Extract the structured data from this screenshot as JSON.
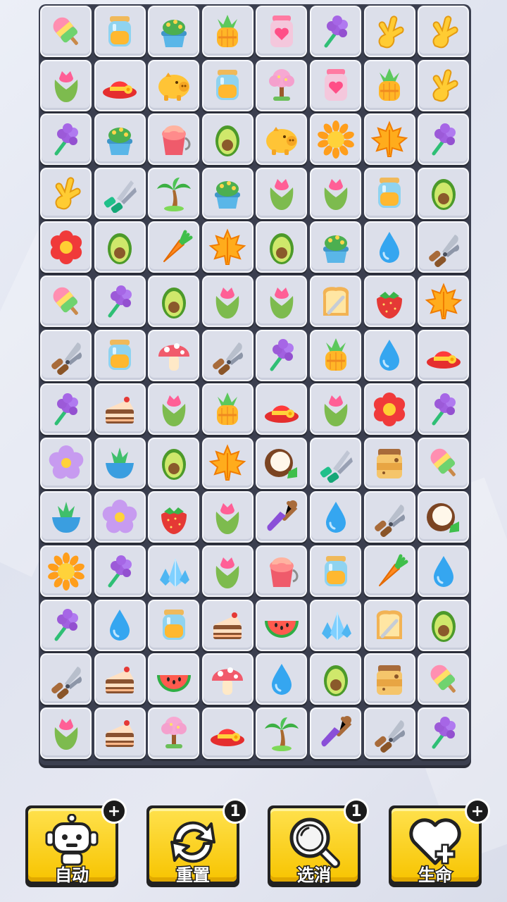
{
  "board": {
    "rows": [
      [
        "popsicle",
        "jar",
        "cactus-pot",
        "pineapple",
        "love-jar",
        "lavender",
        "ginger",
        "ginger"
      ],
      [
        "tulip",
        "red-hat",
        "gold-pig",
        "jar",
        "cherry-tree",
        "love-jar",
        "pineapple",
        "ginger"
      ],
      [
        "lavender",
        "cactus-pot",
        "paint-bucket",
        "avocado",
        "gold-pig",
        "sunflower",
        "maple-leaf",
        "lavender"
      ],
      [
        "ginger",
        "shears",
        "palm-tree",
        "cactus-pot",
        "tulip",
        "tulip",
        "jar",
        "avocado"
      ],
      [
        "red-flower",
        "avocado",
        "carrot",
        "maple-leaf",
        "avocado",
        "cactus-pot",
        "water-drop",
        "pruners"
      ],
      [
        "popsicle",
        "lavender",
        "avocado",
        "tulip",
        "tulip",
        "toast",
        "strawberry",
        "maple-leaf"
      ],
      [
        "pruners",
        "jar",
        "mushroom",
        "pruners",
        "lavender",
        "pineapple",
        "water-drop",
        "red-hat"
      ],
      [
        "lavender",
        "cake",
        "tulip",
        "pineapple",
        "red-hat",
        "tulip",
        "red-flower",
        "lavender"
      ],
      [
        "violet-flower",
        "plant-bowl",
        "avocado",
        "maple-leaf",
        "coconut",
        "shears",
        "honey-jar",
        "popsicle"
      ],
      [
        "plant-bowl",
        "violet-flower",
        "strawberry",
        "tulip",
        "shovel",
        "water-drop",
        "pruners",
        "coconut"
      ],
      [
        "sunflower",
        "lavender",
        "crystal",
        "tulip",
        "paint-bucket",
        "jar",
        "carrot",
        "water-drop"
      ],
      [
        "lavender",
        "water-drop",
        "jar",
        "cake",
        "watermelon",
        "crystal",
        "toast",
        "avocado"
      ],
      [
        "pruners",
        "cake",
        "watermelon",
        "mushroom",
        "water-drop",
        "avocado",
        "honey-jar",
        "popsicle"
      ],
      [
        "tulip",
        "cake",
        "cherry-tree",
        "red-hat",
        "palm-tree",
        "shovel",
        "pruners",
        "lavender"
      ]
    ]
  },
  "tools": [
    {
      "label": "自动",
      "badge": "+",
      "icon": "robot-icon"
    },
    {
      "label": "重置",
      "badge": "1",
      "icon": "shuffle-icon"
    },
    {
      "label": "选消",
      "badge": "1",
      "icon": "magnifier-icon"
    },
    {
      "label": "生命",
      "badge": "+",
      "icon": "heart-plus-icon"
    }
  ]
}
